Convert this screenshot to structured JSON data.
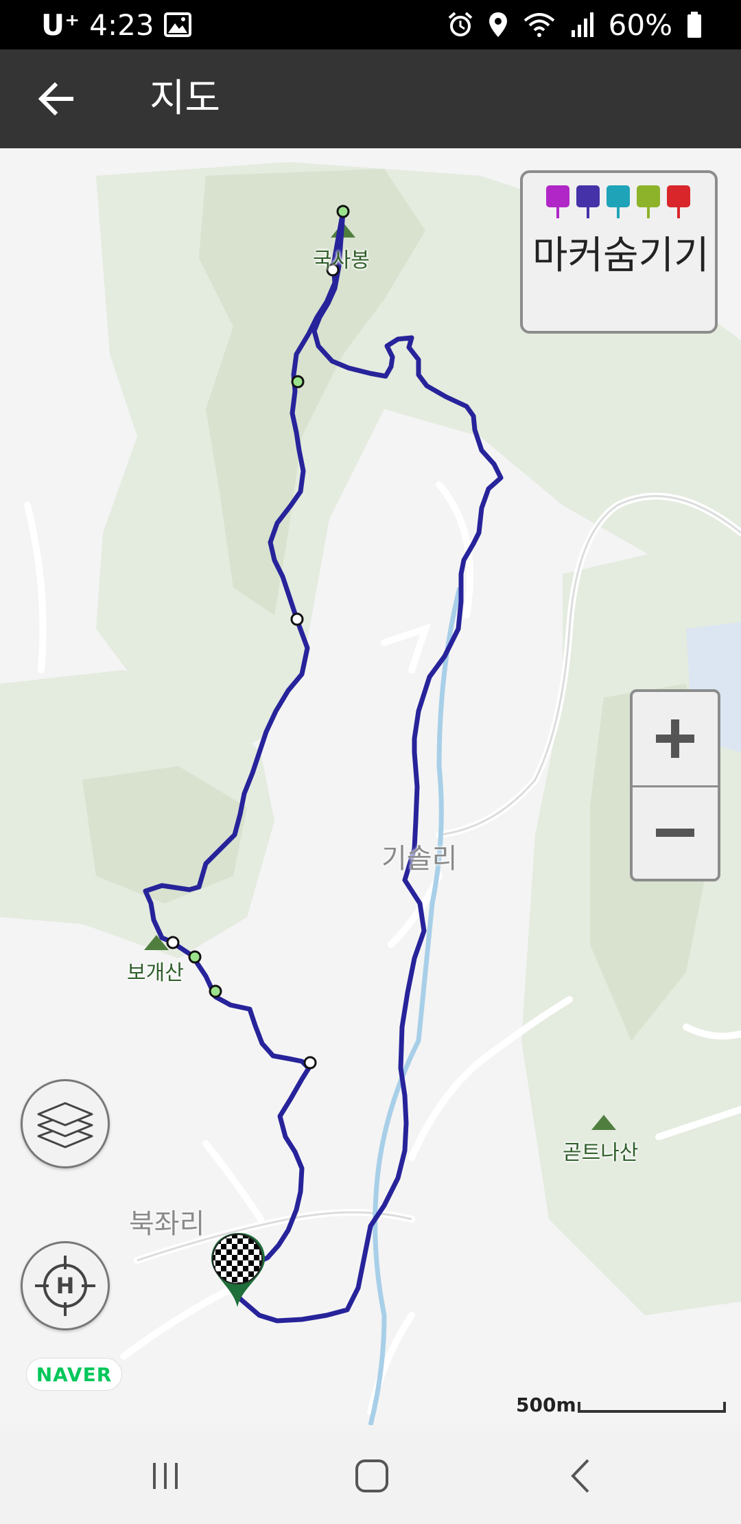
{
  "status_bar": {
    "carrier": "U⁺",
    "time": "4:23",
    "battery": "60%"
  },
  "app_bar": {
    "title": "지도",
    "back_icon": "arrow-left-icon"
  },
  "map": {
    "marker_panel": {
      "label": "마커숨기기",
      "icons": [
        {
          "name": "camera-marker-icon",
          "color": "#b026c6"
        },
        {
          "name": "video-marker-icon",
          "color": "#4632a8"
        },
        {
          "name": "mic-marker-icon",
          "color": "#1fa3b8"
        },
        {
          "name": "memo-marker-icon",
          "color": "#8db32a"
        },
        {
          "name": "location-marker-icon",
          "color": "#d9262b"
        }
      ]
    },
    "labels": {
      "peak1": "국사봉",
      "peak2": "보개산",
      "peak3": "곧트나산",
      "village1": "기솔리",
      "village2": "북좌리"
    },
    "zoom": {
      "in_icon": "plus-icon",
      "out_icon": "minus-icon"
    },
    "layers_icon": "layers-icon",
    "locate_icon": "home-locate-icon",
    "logo": "NAVER",
    "scale": "500m",
    "track_color": "#27239a",
    "finish_icon": "checkered-flag-icon"
  },
  "nav_bar": {
    "recent_icon": "recent-apps-icon",
    "home_icon": "home-icon",
    "back_icon": "back-chevron-icon"
  }
}
